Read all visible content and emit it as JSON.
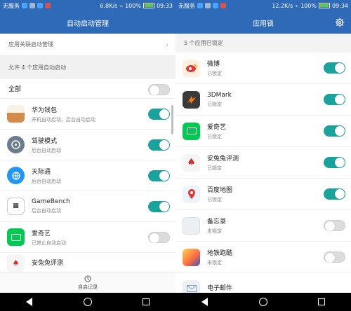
{
  "left": {
    "status": {
      "carrier": "无服务",
      "speed": "6.8K/s",
      "battery": "100%",
      "time": "09:33"
    },
    "title": "自动启动管理",
    "manage_row": "应用关联启动管理",
    "section": "允许 4 个应用自动启动",
    "all_label": "全部",
    "apps": [
      {
        "name": "华为钱包",
        "status": "开机自动启动，后台自动启动",
        "icon": "huawei-wallet-icon",
        "enabled": true
      },
      {
        "name": "驾驶模式",
        "status": "后台自动启动",
        "icon": "drive-mode-icon",
        "enabled": true
      },
      {
        "name": "天际通",
        "status": "后台自动启动",
        "icon": "skytone-icon",
        "enabled": true
      },
      {
        "name": "GameBench",
        "status": "后台自动启动",
        "icon": "gamebench-icon",
        "enabled": true
      },
      {
        "name": "爱奇艺",
        "status": "已禁止自动启动",
        "icon": "iqiyi-icon",
        "enabled": false
      },
      {
        "name": "安兔兔评测",
        "status": "",
        "icon": "antutu-icon",
        "enabled": false
      }
    ],
    "bottom_tab": "自启记录"
  },
  "right": {
    "status": {
      "carrier": "无服务",
      "speed": "12.2K/s",
      "battery": "100%",
      "time": "09:34"
    },
    "title": "应用锁",
    "section": "5 个应用已锁定",
    "apps": [
      {
        "name": "微博",
        "status": "已锁定",
        "icon": "weibo-icon",
        "enabled": true
      },
      {
        "name": "3DMark",
        "status": "已锁定",
        "icon": "3dmark-icon",
        "enabled": true
      },
      {
        "name": "爱奇艺",
        "status": "已锁定",
        "icon": "iqiyi-icon",
        "enabled": true
      },
      {
        "name": "安兔兔评测",
        "status": "已锁定",
        "icon": "antutu-icon",
        "enabled": true
      },
      {
        "name": "百度地图",
        "status": "已锁定",
        "icon": "baidu-map-icon",
        "enabled": true
      },
      {
        "name": "备忘录",
        "status": "未锁定",
        "icon": "memo-icon",
        "enabled": false
      },
      {
        "name": "地铁跑酷",
        "status": "未锁定",
        "icon": "subway-surfers-icon",
        "enabled": false
      },
      {
        "name": "电子邮件",
        "status": "",
        "icon": "email-icon",
        "enabled": false
      }
    ]
  },
  "colors": {
    "header": "#2f6ab8",
    "toggle_on": "#1aa39c",
    "toggle_off": "#dcdcdc"
  }
}
